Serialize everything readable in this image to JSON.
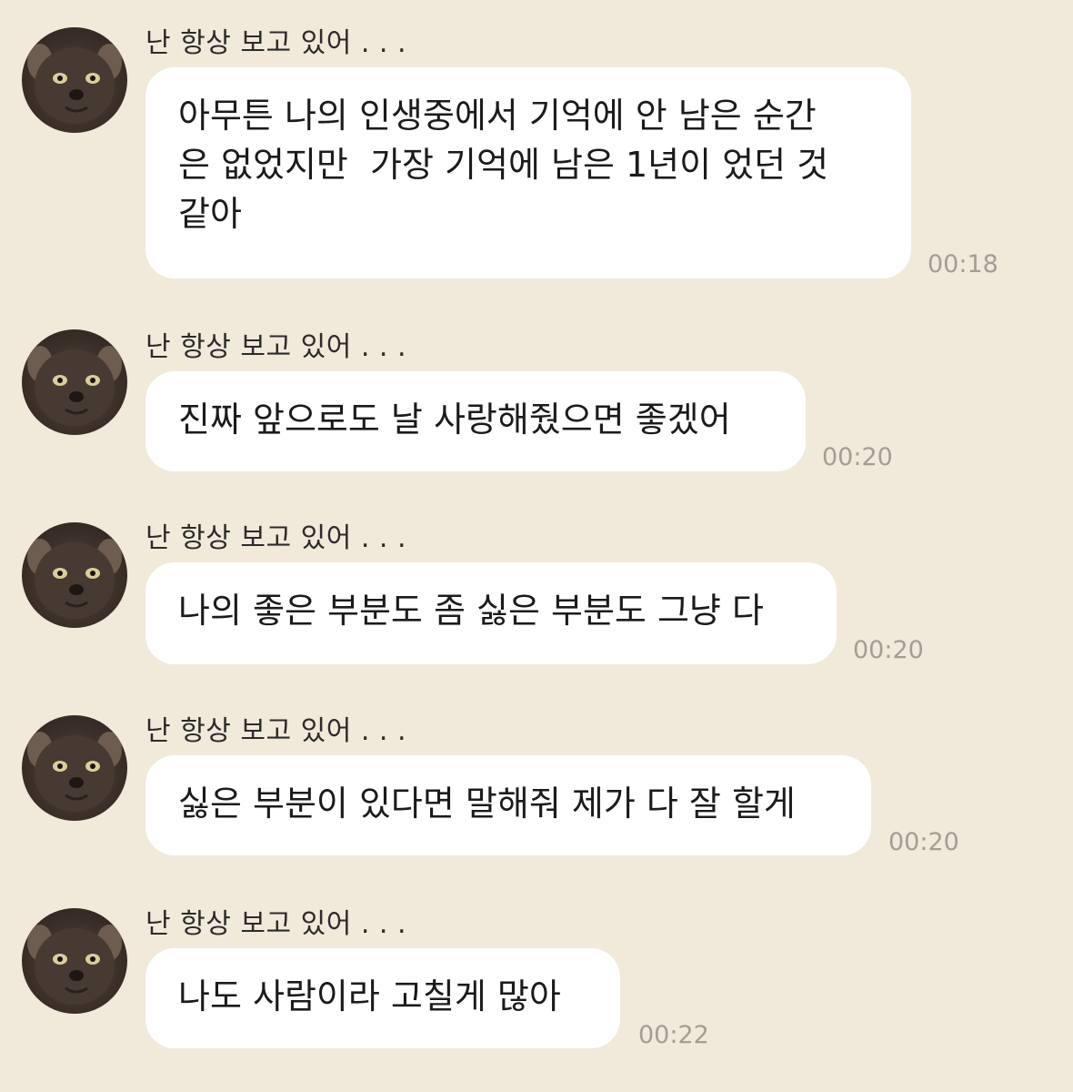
{
  "messages": [
    {
      "sender": "난 항상 보고 있어 . . .",
      "text": "아무튼 나의 인생중에서 기억에 안 남은 순간\n은 없었지만  가장 기억에 남은 1년이 었던 것\n같아",
      "time": "00:18"
    },
    {
      "sender": "난 항상 보고 있어 . . .",
      "text": "진짜 앞으로도 날 사랑해줬으면 좋겠어",
      "time": "00:20"
    },
    {
      "sender": "난 항상 보고 있어 . . .",
      "text": "나의 좋은 부분도 좀 싫은 부분도 그냥 다",
      "time": "00:20"
    },
    {
      "sender": "난 항상 보고 있어 . . .",
      "text": "싫은 부분이 있다면 말해줘 제가 다 잘 할게",
      "time": "00:20"
    },
    {
      "sender": "난 항상 보고 있어 . . .",
      "text": "나도 사람이라 고칠게 많아",
      "time": "00:22"
    }
  ]
}
